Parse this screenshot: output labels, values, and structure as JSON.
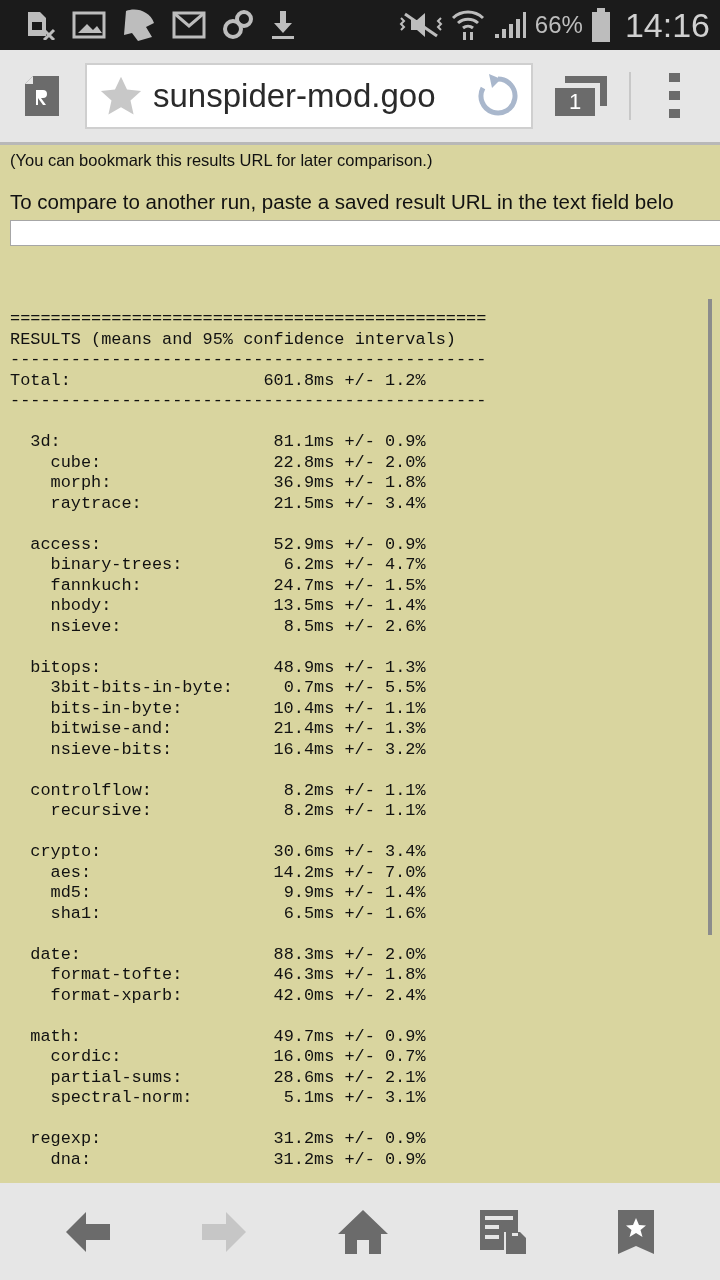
{
  "status_bar": {
    "battery": "66%",
    "time": "14:16"
  },
  "toolbar": {
    "url": "sunspider-mod.goo",
    "tab_count": "1"
  },
  "page": {
    "bookmark_note": "(You can bookmark this results URL for later comparison.)",
    "compare_prompt": "To compare to another run, paste a saved result URL in the text field belo",
    "results": {
      "rule_top": "===============================================",
      "title": "RESULTS (means and 95% confidence intervals)",
      "rule_mid": "-----------------------------------------------",
      "total": {
        "label": "Total:",
        "time": "601.8ms",
        "ci": "+/- 1.2%"
      },
      "rule_bottom": "-----------------------------------------------",
      "groups": [
        {
          "name": "3d:",
          "time": "81.1ms",
          "ci": "+/- 0.9%",
          "tests": [
            {
              "name": "cube:",
              "time": "22.8ms",
              "ci": "+/- 2.0%"
            },
            {
              "name": "morph:",
              "time": "36.9ms",
              "ci": "+/- 1.8%"
            },
            {
              "name": "raytrace:",
              "time": "21.5ms",
              "ci": "+/- 3.4%"
            }
          ]
        },
        {
          "name": "access:",
          "time": "52.9ms",
          "ci": "+/- 0.9%",
          "tests": [
            {
              "name": "binary-trees:",
              "time": "6.2ms",
              "ci": "+/- 4.7%"
            },
            {
              "name": "fannkuch:",
              "time": "24.7ms",
              "ci": "+/- 1.5%"
            },
            {
              "name": "nbody:",
              "time": "13.5ms",
              "ci": "+/- 1.4%"
            },
            {
              "name": "nsieve:",
              "time": "8.5ms",
              "ci": "+/- 2.6%"
            }
          ]
        },
        {
          "name": "bitops:",
          "time": "48.9ms",
          "ci": "+/- 1.3%",
          "tests": [
            {
              "name": "3bit-bits-in-byte:",
              "time": "0.7ms",
              "ci": "+/- 5.5%"
            },
            {
              "name": "bits-in-byte:",
              "time": "10.4ms",
              "ci": "+/- 1.1%"
            },
            {
              "name": "bitwise-and:",
              "time": "21.4ms",
              "ci": "+/- 1.3%"
            },
            {
              "name": "nsieve-bits:",
              "time": "16.4ms",
              "ci": "+/- 3.2%"
            }
          ]
        },
        {
          "name": "controlflow:",
          "time": "8.2ms",
          "ci": "+/- 1.1%",
          "tests": [
            {
              "name": "recursive:",
              "time": "8.2ms",
              "ci": "+/- 1.1%"
            }
          ]
        },
        {
          "name": "crypto:",
          "time": "30.6ms",
          "ci": "+/- 3.4%",
          "tests": [
            {
              "name": "aes:",
              "time": "14.2ms",
              "ci": "+/- 7.0%"
            },
            {
              "name": "md5:",
              "time": "9.9ms",
              "ci": "+/- 1.4%"
            },
            {
              "name": "sha1:",
              "time": "6.5ms",
              "ci": "+/- 1.6%"
            }
          ]
        },
        {
          "name": "date:",
          "time": "88.3ms",
          "ci": "+/- 2.0%",
          "tests": [
            {
              "name": "format-tofte:",
              "time": "46.3ms",
              "ci": "+/- 1.8%"
            },
            {
              "name": "format-xparb:",
              "time": "42.0ms",
              "ci": "+/- 2.4%"
            }
          ]
        },
        {
          "name": "math:",
          "time": "49.7ms",
          "ci": "+/- 0.9%",
          "tests": [
            {
              "name": "cordic:",
              "time": "16.0ms",
              "ci": "+/- 0.7%"
            },
            {
              "name": "partial-sums:",
              "time": "28.6ms",
              "ci": "+/- 2.1%"
            },
            {
              "name": "spectral-norm:",
              "time": "5.1ms",
              "ci": "+/- 3.1%"
            }
          ]
        },
        {
          "name": "regexp:",
          "time": "31.2ms",
          "ci": "+/- 0.9%",
          "tests": [
            {
              "name": "dna:",
              "time": "31.2ms",
              "ci": "+/- 0.9%"
            }
          ]
        }
      ]
    }
  }
}
